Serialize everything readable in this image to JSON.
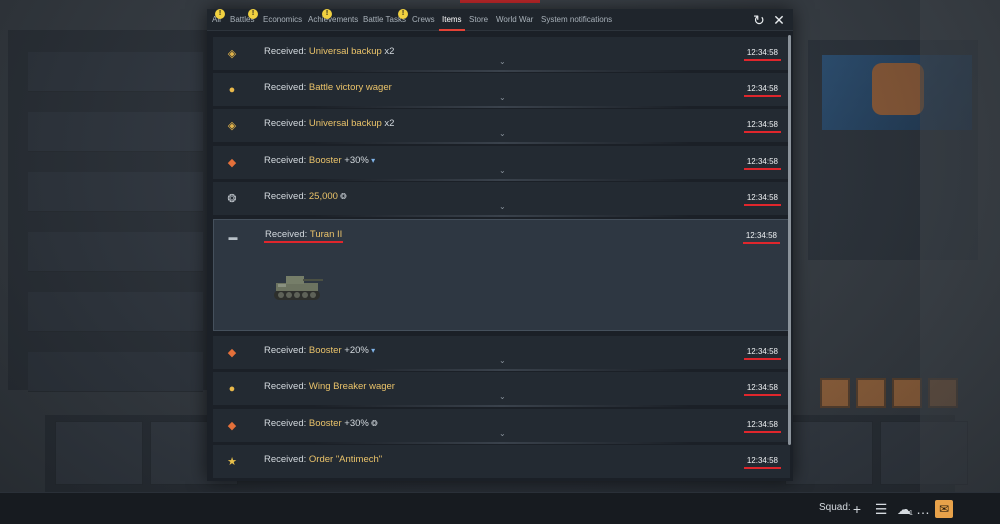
{
  "tabs": [
    {
      "label": "All",
      "warning": true
    },
    {
      "label": "Battles",
      "warning": true
    },
    {
      "label": "Economics",
      "warning": false
    },
    {
      "label": "Achievements",
      "warning": true
    },
    {
      "label": "Battle Tasks",
      "warning": true
    },
    {
      "label": "Crews",
      "warning": false
    },
    {
      "label": "Items",
      "warning": false,
      "active": true
    },
    {
      "label": "Store",
      "warning": false
    },
    {
      "label": "World War",
      "warning": false
    },
    {
      "label": "System notifications",
      "warning": false
    }
  ],
  "warning_glyph": "!",
  "tools": {
    "refresh_icon": "refresh-icon",
    "close_icon": "close-icon"
  },
  "notifications": [
    {
      "icon": "backup-icon",
      "prefix": "Received: ",
      "name": "Universal backup",
      "suffix": " x2",
      "time": "12:34:58"
    },
    {
      "icon": "wager-icon",
      "prefix": "Received: ",
      "name": "Battle victory wager",
      "suffix": "",
      "time": "12:34:58"
    },
    {
      "icon": "backup-icon",
      "prefix": "Received: ",
      "name": "Universal backup",
      "suffix": " x2",
      "time": "12:34:58"
    },
    {
      "icon": "booster-icon",
      "prefix": "Received: ",
      "name": "Booster",
      "suffix": " +30%",
      "time": "12:34:58"
    },
    {
      "icon": "silver-lions-icon",
      "prefix": "Received: ",
      "name": "25,000",
      "suffix": "",
      "time": "12:34:58"
    },
    {
      "icon": "tank-icon",
      "prefix": "Received: ",
      "name": "Turan II",
      "suffix": "",
      "time": "12:34:58",
      "expanded": true
    },
    {
      "icon": "booster-icon",
      "prefix": "Received: ",
      "name": "Booster",
      "suffix": " +20%",
      "time": "12:34:58"
    },
    {
      "icon": "wager-icon",
      "prefix": "Received: ",
      "name": "Wing Breaker wager",
      "suffix": "",
      "time": "12:34:58"
    },
    {
      "icon": "booster-icon",
      "prefix": "Received: ",
      "name": "Booster",
      "suffix": " +30%",
      "time": "12:34:58"
    },
    {
      "icon": "order-icon",
      "prefix": "Received: ",
      "name": "Order \"Antimech\"",
      "suffix": "",
      "time": "12:34:58"
    }
  ],
  "bottombar": {
    "squad_label": "Squad:",
    "icons": [
      "add-squad-icon",
      "list-icon",
      "contacts-icon",
      "chat-icon",
      "mail-icon"
    ],
    "contacts_badge": "1"
  },
  "colors": {
    "accent_red": "#e0262c",
    "item_name": "#eac36a",
    "warning": "#f1d140"
  }
}
